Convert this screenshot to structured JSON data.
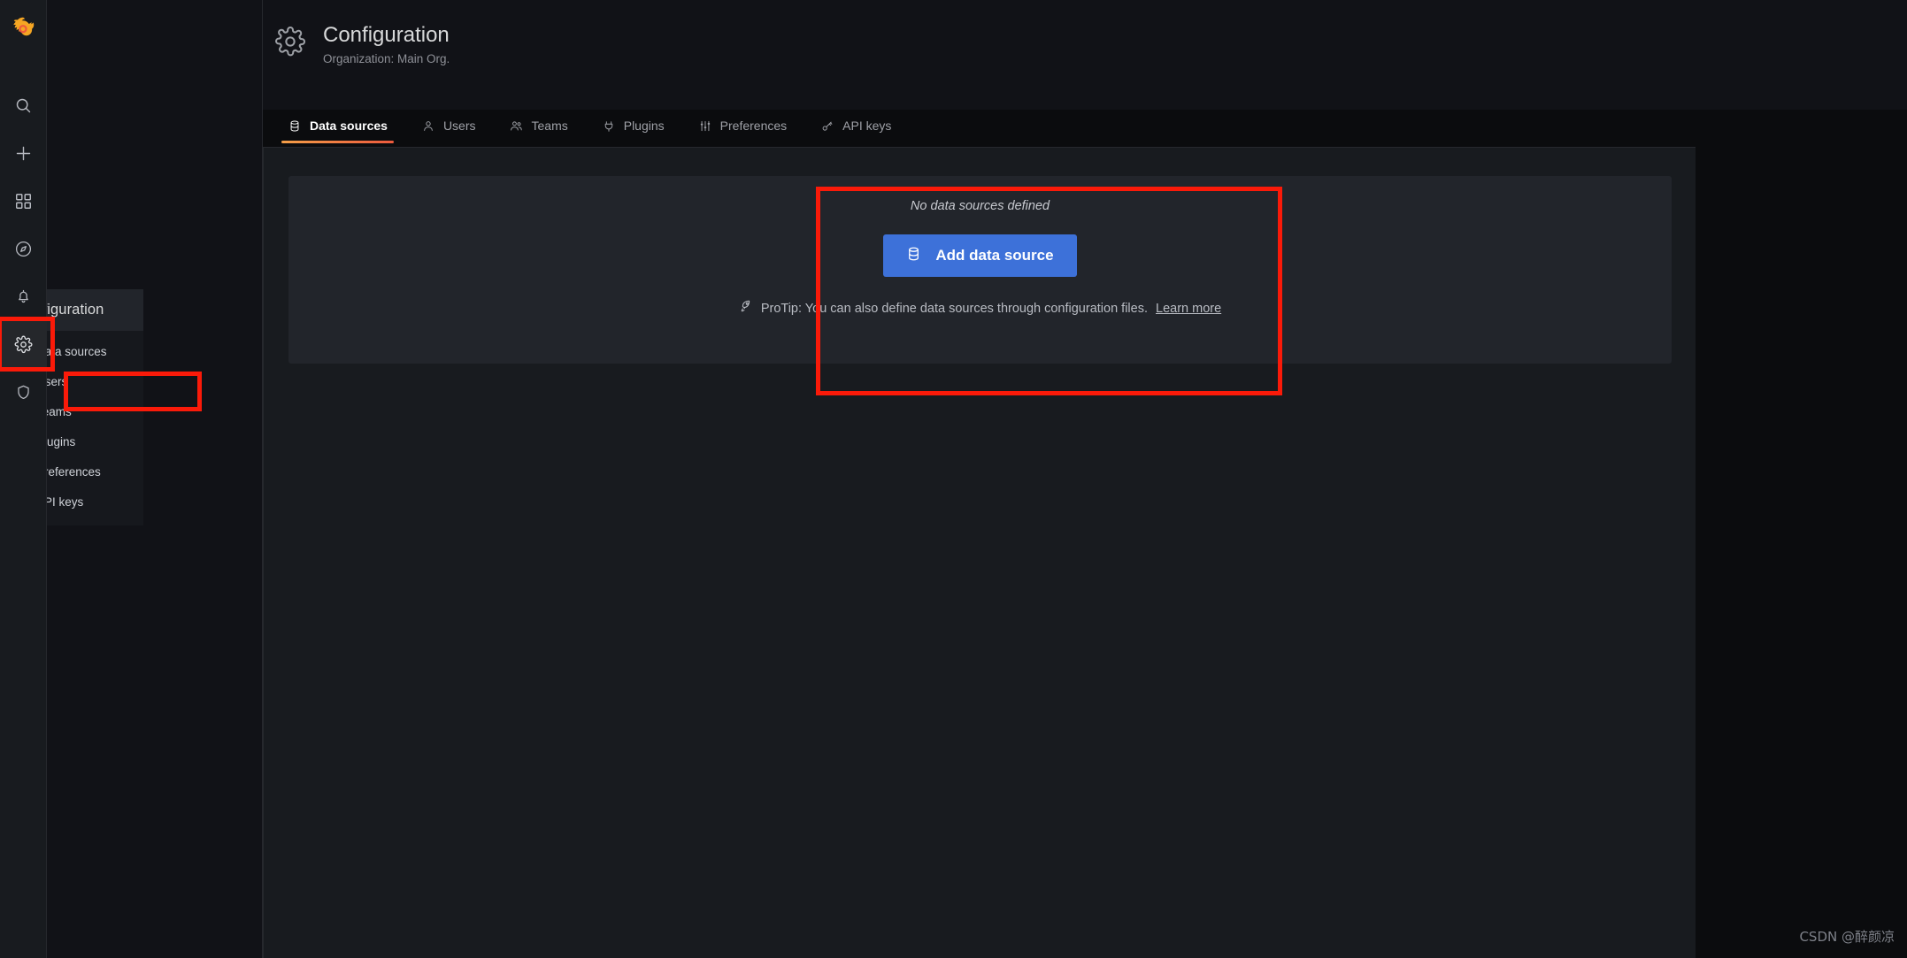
{
  "app": {
    "brand": "grafana-logo",
    "watermark": "CSDN @醉颜凉"
  },
  "rail": {
    "items": [
      {
        "name": "search-icon",
        "label": "Search"
      },
      {
        "name": "plus-icon",
        "label": "Create"
      },
      {
        "name": "dashboards-icon",
        "label": "Dashboards"
      },
      {
        "name": "compass-icon",
        "label": "Explore"
      },
      {
        "name": "bell-icon",
        "label": "Alerting"
      },
      {
        "name": "gear-icon",
        "label": "Configuration"
      },
      {
        "name": "shield-icon",
        "label": "Server Admin"
      }
    ]
  },
  "flyout": {
    "title": "Configuration",
    "items": [
      {
        "label": "Data sources",
        "icon": "database-icon"
      },
      {
        "label": "Users",
        "icon": "user-icon"
      },
      {
        "label": "Teams",
        "icon": "users-icon"
      },
      {
        "label": "Plugins",
        "icon": "plug-icon"
      },
      {
        "label": "Preferences",
        "icon": "sliders-icon"
      },
      {
        "label": "API keys",
        "icon": "key-icon"
      }
    ]
  },
  "header": {
    "title": "Configuration",
    "subtitle": "Organization: Main Org.",
    "icon": "gear-icon"
  },
  "tabs": [
    {
      "label": "Data sources",
      "icon": "database-icon",
      "active": true
    },
    {
      "label": "Users",
      "icon": "user-icon",
      "active": false
    },
    {
      "label": "Teams",
      "icon": "users-icon",
      "active": false
    },
    {
      "label": "Plugins",
      "icon": "plug-icon",
      "active": false
    },
    {
      "label": "Preferences",
      "icon": "sliders-icon",
      "active": false
    },
    {
      "label": "API keys",
      "icon": "key-icon",
      "active": false
    }
  ],
  "main": {
    "empty_text": "No data sources defined",
    "add_button_label": "Add data source",
    "add_button_icon": "database-icon",
    "protip_icon": "rocket-icon",
    "protip_text": "ProTip: You can also define data sources through configuration files.",
    "protip_link": "Learn more"
  },
  "colors": {
    "accent_orange_start": "#f59f48",
    "accent_orange_end": "#ed5a3d",
    "primary_blue": "#3d71d9",
    "annotation_red": "#fa1a09",
    "page_bg": "#111217",
    "content_bg": "#181b1f",
    "card_bg": "#22252b"
  }
}
